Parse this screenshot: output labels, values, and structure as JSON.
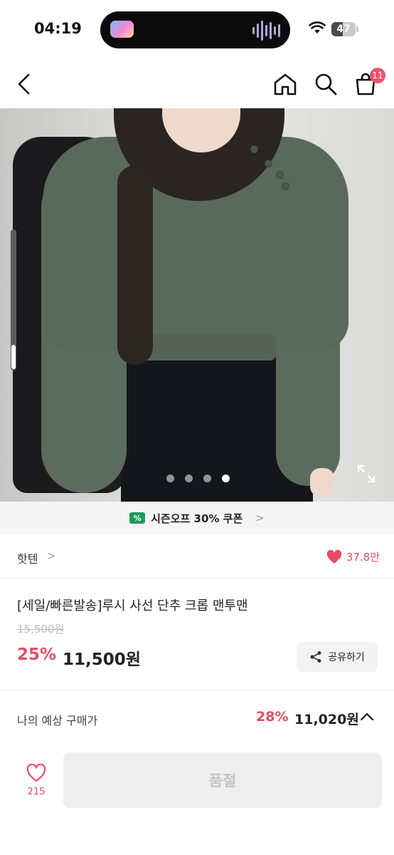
{
  "status_bar": {
    "time": "04:19",
    "battery": "47",
    "battery_level": 0.47
  },
  "nav": {
    "back_icon": "chevron-left-icon",
    "home_icon": "home-icon",
    "search_icon": "search-icon",
    "cart_icon": "shopping-bag-icon",
    "cart_count": "11"
  },
  "hero": {
    "total_images": 4,
    "active_index": 4,
    "expand_icon": "expand-icon"
  },
  "coupon": {
    "icon_text": "%",
    "label": "시즌오프 30% 쿠폰",
    "arrow": ">"
  },
  "brand": {
    "name": "핫텐",
    "arrow": ">",
    "like_count": "37.8만"
  },
  "product": {
    "title": "[세일/빠른발송]루시 사선 단추 크롭 맨투맨",
    "original_price": "15,500원",
    "discount_rate": "25%",
    "sale_price": "11,500원",
    "share_label": "공유하기"
  },
  "expected": {
    "label": "나의 예상 구매가",
    "rate": "28%",
    "price": "11,020원"
  },
  "bottom": {
    "wish_count": "215",
    "soldout_label": "품절"
  },
  "colors": {
    "accent": "#e84a65",
    "coupon_green": "#1f9a5f"
  }
}
